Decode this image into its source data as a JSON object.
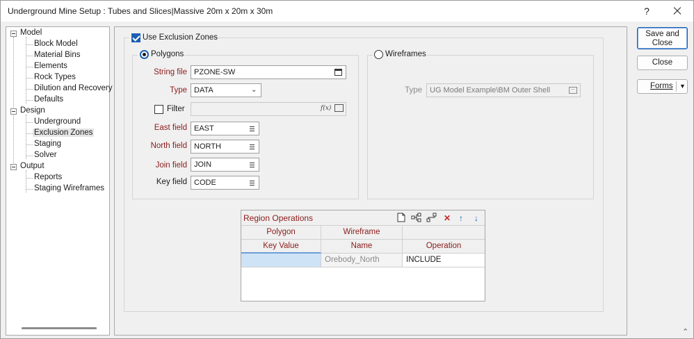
{
  "window": {
    "title": "Underground Mine Setup : Tubes and Slices|Massive 20m x 20m x 30m",
    "help_label": "?"
  },
  "tree": {
    "groups": [
      {
        "label": "Model",
        "items": [
          "Block Model",
          "Material Bins",
          "Elements",
          "Rock Types",
          "Dilution and Recovery",
          "Defaults"
        ]
      },
      {
        "label": "Design",
        "items": [
          "Underground",
          "Exclusion Zones",
          "Staging",
          "Solver"
        ]
      },
      {
        "label": "Output",
        "items": [
          "Reports",
          "Staging Wireframes"
        ]
      }
    ],
    "selected": "Exclusion Zones"
  },
  "exclusion": {
    "use_label": "Use Exclusion Zones",
    "use_checked": true
  },
  "polygons": {
    "radio_label": "Polygons",
    "selected": true,
    "string_file_label": "String file",
    "string_file_value": "PZONE-SW",
    "type_label": "Type",
    "type_value": "DATA",
    "filter_label": "Filter",
    "filter_value": "",
    "filter_fx": "f(x)",
    "east_label": "East field",
    "east_value": "EAST",
    "north_label": "North field",
    "north_value": "NORTH",
    "join_label": "Join field",
    "join_value": "JOIN",
    "key_label": "Key field",
    "key_value": "CODE"
  },
  "wireframes": {
    "radio_label": "Wireframes",
    "selected": false,
    "type_label": "Type",
    "type_value": "UG Model Example\\BM Outer Shell"
  },
  "region": {
    "title": "Region Operations",
    "group_headers": [
      "Polygon",
      "Wireframe",
      ""
    ],
    "headers": [
      "Key Value",
      "Name",
      "Operation"
    ],
    "rows": [
      {
        "key": "",
        "name": "Orebody_North",
        "operation": "INCLUDE"
      }
    ],
    "tools": [
      "new-icon",
      "tree-add-icon",
      "tree-remove-icon",
      "delete-icon",
      "up-arrow-icon",
      "down-arrow-icon"
    ]
  },
  "buttons": {
    "save_close": "Save and Close",
    "close": "Close",
    "forms": "Forms"
  },
  "colors": {
    "accent": "#1a5fb4",
    "label_red": "#8b1a1a",
    "delete_red": "#c62828"
  }
}
